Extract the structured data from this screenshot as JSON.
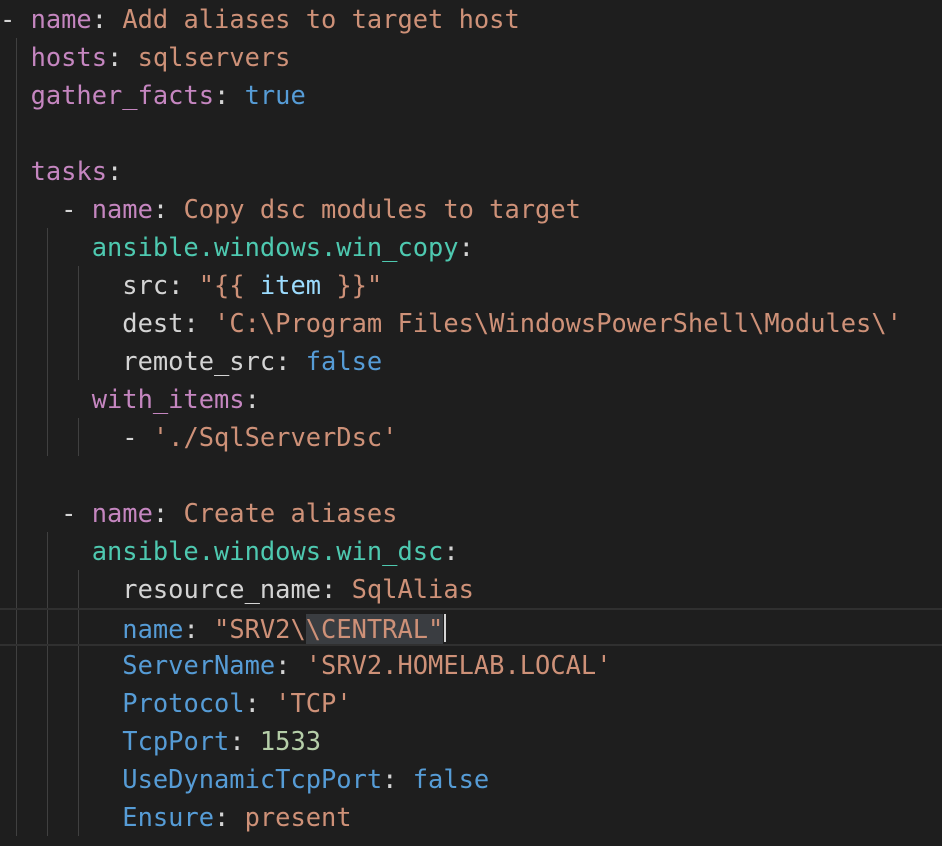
{
  "editor": {
    "lines": [
      {
        "tokens": [
          {
            "t": "- ",
            "c": "tok-dash"
          },
          {
            "t": "name",
            "c": "tok-key"
          },
          {
            "t": ": ",
            "c": "tok-punc"
          },
          {
            "t": "Add aliases to target host",
            "c": "tok-str"
          }
        ]
      },
      {
        "tokens": [
          {
            "t": "  ",
            "c": "tok-plain"
          },
          {
            "t": "hosts",
            "c": "tok-key"
          },
          {
            "t": ": ",
            "c": "tok-punc"
          },
          {
            "t": "sqlservers",
            "c": "tok-str"
          }
        ]
      },
      {
        "tokens": [
          {
            "t": "  ",
            "c": "tok-plain"
          },
          {
            "t": "gather_facts",
            "c": "tok-key"
          },
          {
            "t": ": ",
            "c": "tok-punc"
          },
          {
            "t": "true",
            "c": "tok-bool"
          }
        ]
      },
      {
        "tokens": []
      },
      {
        "tokens": [
          {
            "t": "  ",
            "c": "tok-plain"
          },
          {
            "t": "tasks",
            "c": "tok-key"
          },
          {
            "t": ":",
            "c": "tok-punc"
          }
        ]
      },
      {
        "tokens": [
          {
            "t": "    - ",
            "c": "tok-dash"
          },
          {
            "t": "name",
            "c": "tok-key"
          },
          {
            "t": ": ",
            "c": "tok-punc"
          },
          {
            "t": "Copy dsc modules to target",
            "c": "tok-str"
          }
        ]
      },
      {
        "tokens": [
          {
            "t": "      ",
            "c": "tok-plain"
          },
          {
            "t": "ansible.windows.win_copy",
            "c": "tok-key2"
          },
          {
            "t": ":",
            "c": "tok-punc"
          }
        ]
      },
      {
        "tokens": [
          {
            "t": "        ",
            "c": "tok-plain"
          },
          {
            "t": "src",
            "c": "tok-key3"
          },
          {
            "t": ": ",
            "c": "tok-punc"
          },
          {
            "t": "\"{{ ",
            "c": "tok-str"
          },
          {
            "t": "item",
            "c": "tok-var"
          },
          {
            "t": " }}\"",
            "c": "tok-str"
          }
        ]
      },
      {
        "tokens": [
          {
            "t": "        ",
            "c": "tok-plain"
          },
          {
            "t": "dest",
            "c": "tok-key3"
          },
          {
            "t": ": ",
            "c": "tok-punc"
          },
          {
            "t": "'C:\\Program Files\\WindowsPowerShell\\Modules\\'",
            "c": "tok-str"
          }
        ]
      },
      {
        "tokens": [
          {
            "t": "        ",
            "c": "tok-plain"
          },
          {
            "t": "remote_src",
            "c": "tok-key3"
          },
          {
            "t": ": ",
            "c": "tok-punc"
          },
          {
            "t": "false",
            "c": "tok-bool"
          }
        ]
      },
      {
        "tokens": [
          {
            "t": "      ",
            "c": "tok-plain"
          },
          {
            "t": "with_items",
            "c": "tok-key"
          },
          {
            "t": ":",
            "c": "tok-punc"
          }
        ]
      },
      {
        "tokens": [
          {
            "t": "        - ",
            "c": "tok-dash"
          },
          {
            "t": "'./SqlServerDsc'",
            "c": "tok-str"
          }
        ]
      },
      {
        "tokens": []
      },
      {
        "tokens": [
          {
            "t": "    - ",
            "c": "tok-dash"
          },
          {
            "t": "name",
            "c": "tok-key"
          },
          {
            "t": ": ",
            "c": "tok-punc"
          },
          {
            "t": "Create aliases",
            "c": "tok-str"
          }
        ]
      },
      {
        "tokens": [
          {
            "t": "      ",
            "c": "tok-plain"
          },
          {
            "t": "ansible.windows.win_dsc",
            "c": "tok-key2"
          },
          {
            "t": ":",
            "c": "tok-punc"
          }
        ]
      },
      {
        "tokens": [
          {
            "t": "        ",
            "c": "tok-plain"
          },
          {
            "t": "resource_name",
            "c": "tok-key3"
          },
          {
            "t": ": ",
            "c": "tok-punc"
          },
          {
            "t": "SqlAlias",
            "c": "tok-str"
          }
        ]
      },
      {
        "current": true,
        "tokens": [
          {
            "t": "        ",
            "c": "tok-plain"
          },
          {
            "t": "name",
            "c": "tok-key4"
          },
          {
            "t": ": ",
            "c": "tok-punc"
          },
          {
            "t": "\"SRV2\\",
            "c": "tok-str"
          },
          {
            "t": "\\CENTRAL\"",
            "c": "tok-str tok-sel"
          }
        ]
      },
      {
        "tokens": [
          {
            "t": "        ",
            "c": "tok-plain"
          },
          {
            "t": "ServerName",
            "c": "tok-key4"
          },
          {
            "t": ": ",
            "c": "tok-punc"
          },
          {
            "t": "'SRV2.HOMELAB.LOCAL'",
            "c": "tok-str"
          }
        ]
      },
      {
        "tokens": [
          {
            "t": "        ",
            "c": "tok-plain"
          },
          {
            "t": "Protocol",
            "c": "tok-key4"
          },
          {
            "t": ": ",
            "c": "tok-punc"
          },
          {
            "t": "'TCP'",
            "c": "tok-str"
          }
        ]
      },
      {
        "tokens": [
          {
            "t": "        ",
            "c": "tok-plain"
          },
          {
            "t": "TcpPort",
            "c": "tok-key4"
          },
          {
            "t": ": ",
            "c": "tok-punc"
          },
          {
            "t": "1533",
            "c": "tok-num"
          }
        ]
      },
      {
        "tokens": [
          {
            "t": "        ",
            "c": "tok-plain"
          },
          {
            "t": "UseDynamicTcpPort",
            "c": "tok-key4"
          },
          {
            "t": ": ",
            "c": "tok-punc"
          },
          {
            "t": "false",
            "c": "tok-bool"
          }
        ]
      },
      {
        "tokens": [
          {
            "t": "        ",
            "c": "tok-plain"
          },
          {
            "t": "Ensure",
            "c": "tok-key4"
          },
          {
            "t": ": ",
            "c": "tok-punc"
          },
          {
            "t": "present",
            "c": "tok-str"
          }
        ]
      }
    ]
  }
}
